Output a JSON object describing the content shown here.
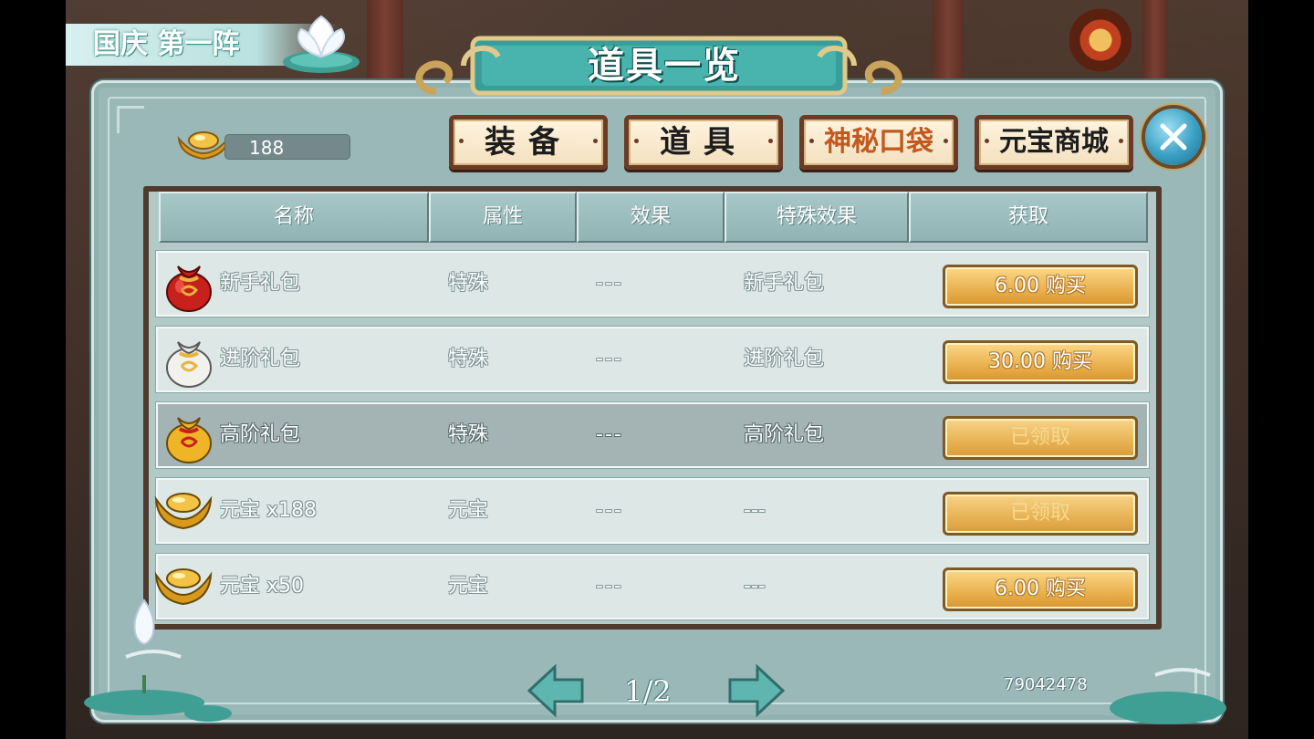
{
  "event_label": "国庆 第一阵",
  "title": "道具一览",
  "currency": {
    "icon": "gold-ingot-icon",
    "value": "188"
  },
  "tabs": [
    {
      "label": "装备",
      "active": false
    },
    {
      "label": "道具",
      "active": false
    },
    {
      "label": "神秘口袋",
      "active": true
    },
    {
      "label": "元宝商城",
      "active": false
    }
  ],
  "table": {
    "headers": [
      "名称",
      "属性",
      "效果",
      "特殊效果",
      "获取"
    ],
    "rows": [
      {
        "icon": "red-bag-icon",
        "name": "新手礼包",
        "attr": "特殊",
        "effect": "---",
        "special": "新手礼包",
        "action": "6.00 购买",
        "claimed": false
      },
      {
        "icon": "white-bag-icon",
        "name": "进阶礼包",
        "attr": "特殊",
        "effect": "---",
        "special": "进阶礼包",
        "action": "30.00 购买",
        "claimed": false
      },
      {
        "icon": "gold-bag-icon",
        "name": "高阶礼包",
        "attr": "特殊",
        "effect": "---",
        "special": "高阶礼包",
        "action": "已领取",
        "claimed": true
      },
      {
        "icon": "gold-ingot-icon",
        "name": "元宝 x188",
        "attr": "元宝",
        "effect": "---",
        "special": "---",
        "action": "已领取",
        "claimed": true
      },
      {
        "icon": "gold-ingot-icon",
        "name": "元宝 x50",
        "attr": "元宝",
        "effect": "---",
        "special": "---",
        "action": "6.00 购买",
        "claimed": false
      }
    ],
    "selected_row": 2
  },
  "pager": {
    "text": "1/2"
  },
  "user_id": "79042478",
  "colors": {
    "panel": "#9ab8b8",
    "tab_active_text": "#c2591e",
    "button_gold": "#e9b04d"
  }
}
